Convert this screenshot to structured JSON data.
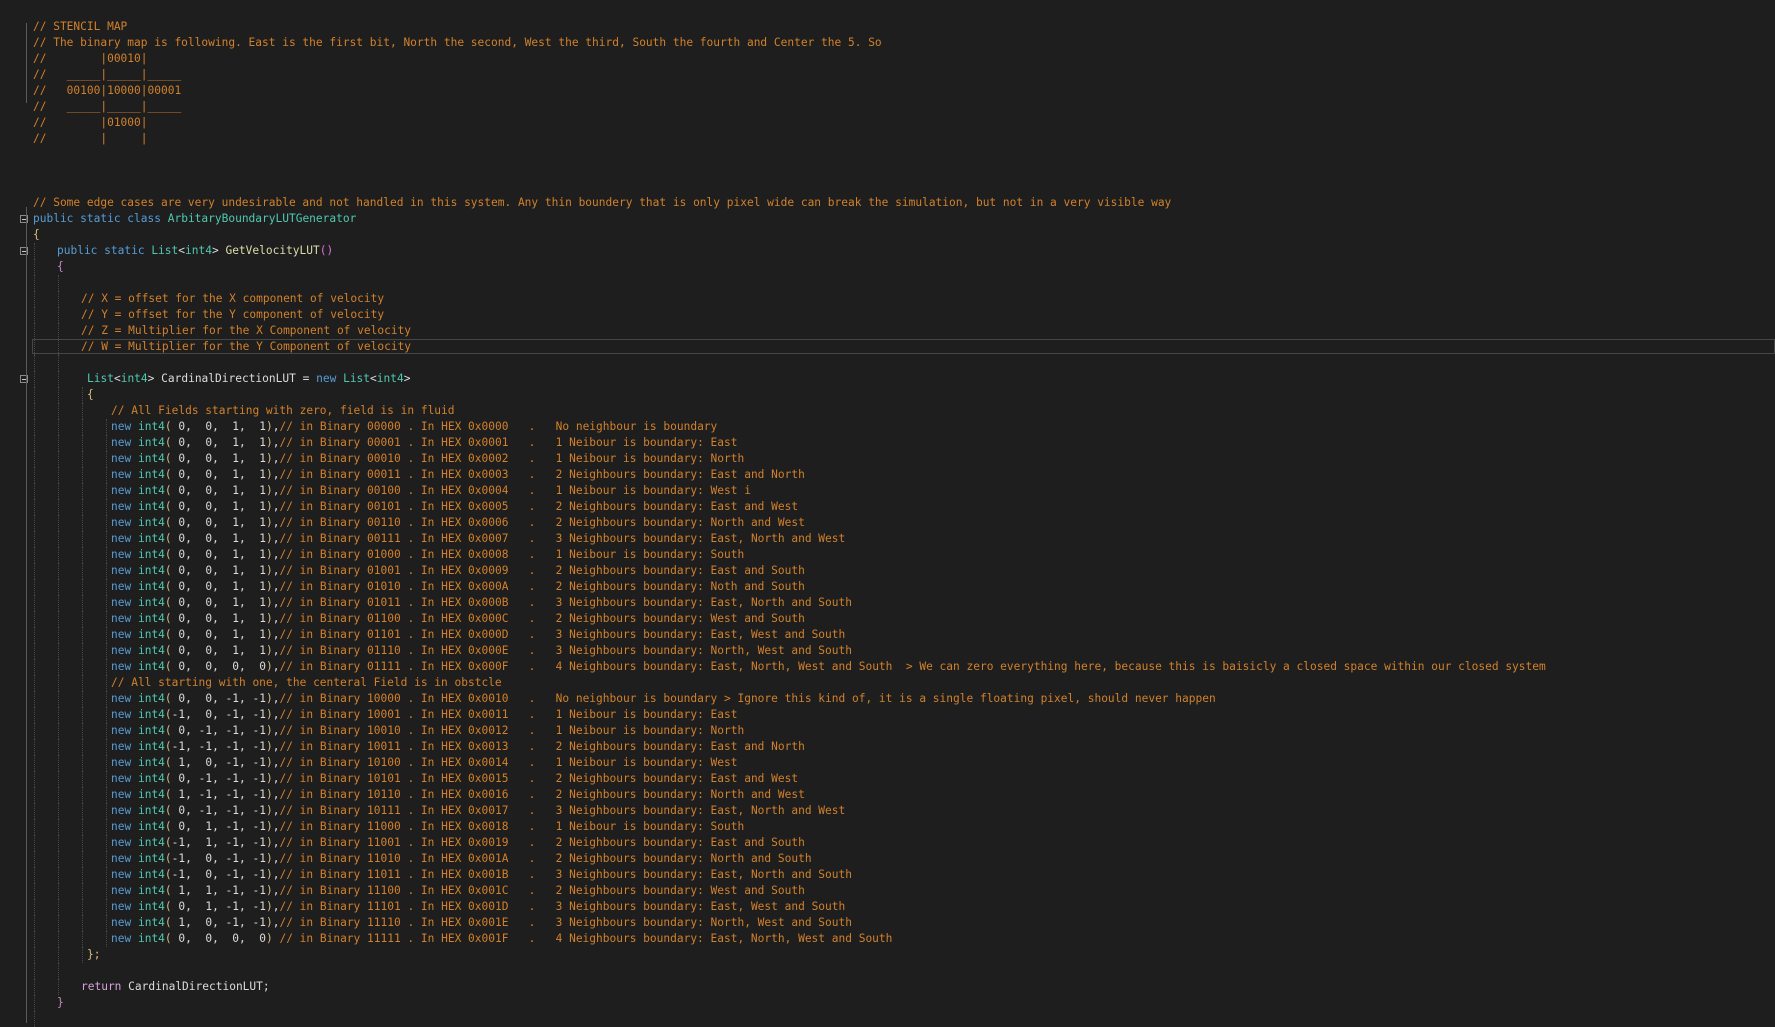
{
  "header_comments": [
    "// STENCIL MAP",
    "// The binary map is following. East is the first bit, North the second, West the third, South the fourth and Center the 5. So",
    "//        |00010|",
    "//   _____|_____|_____",
    "//   00100|10000|00001",
    "//   _____|_____|_____",
    "//        |01000|",
    "//        |     |"
  ],
  "edge_case_comment": "// Some edge cases are very undesirable and not handled in this system. Any thin boundery that is only pixel wide can break the simulation, but not in a very visible way",
  "class_decl": {
    "modifiers": "public static class",
    "name": "ArbitaryBoundaryLUTGenerator"
  },
  "open_brace": "{",
  "close_brace": "}",
  "method_decl": {
    "modifiers": "public static",
    "return_type": "List",
    "generic_arg": "int4",
    "name": "GetVelocityLUT",
    "parens": "()"
  },
  "param_comments": [
    "// X = offset for the X component of velocity",
    "// Y = offset for the Y component of velocity",
    "// Z = Multiplier for the X Component of velocity",
    "// W = Multiplier for the Y Component of velocity"
  ],
  "list_decl": {
    "type": "List",
    "generic_arg": "int4",
    "var": "CardinalDirectionLUT",
    "op": "=",
    "new_kw": "new"
  },
  "init_open": "{",
  "init_close": "};",
  "fluid_comment": "// All Fields starting with zero, field is in fluid",
  "obstacle_comment": "// All starting with one, the centeral Field is in obstcle",
  "entry_keyword": "new",
  "entry_type": "int4",
  "entries_fluid": [
    {
      "args": " 0,  0,  1,  1",
      "comment": "// in Binary 00000 . In HEX 0x0000   .   No neighbour is boundary"
    },
    {
      "args": " 0,  0,  1,  1",
      "comment": "// in Binary 00001 . In HEX 0x0001   .   1 Neibour is boundary: East"
    },
    {
      "args": " 0,  0,  1,  1",
      "comment": "// in Binary 00010 . In HEX 0x0002   .   1 Neibour is boundary: North"
    },
    {
      "args": " 0,  0,  1,  1",
      "comment": "// in Binary 00011 . In HEX 0x0003   .   2 Neighbours boundary: East and North"
    },
    {
      "args": " 0,  0,  1,  1",
      "comment": "// in Binary 00100 . In HEX 0x0004   .   1 Neibour is boundary: West i"
    },
    {
      "args": " 0,  0,  1,  1",
      "comment": "// in Binary 00101 . In HEX 0x0005   .   2 Neighbours boundary: East and West"
    },
    {
      "args": " 0,  0,  1,  1",
      "comment": "// in Binary 00110 . In HEX 0x0006   .   2 Neighbours boundary: North and West"
    },
    {
      "args": " 0,  0,  1,  1",
      "comment": "// in Binary 00111 . In HEX 0x0007   .   3 Neighbours boundary: East, North and West"
    },
    {
      "args": " 0,  0,  1,  1",
      "comment": "// in Binary 01000 . In HEX 0x0008   .   1 Neibour is boundary: South"
    },
    {
      "args": " 0,  0,  1,  1",
      "comment": "// in Binary 01001 . In HEX 0x0009   .   2 Neighbours boundary: East and South"
    },
    {
      "args": " 0,  0,  1,  1",
      "comment": "// in Binary 01010 . In HEX 0x000A   .   2 Neighbours boundary: Noth and South"
    },
    {
      "args": " 0,  0,  1,  1",
      "comment": "// in Binary 01011 . In HEX 0x000B   .   3 Neighbours boundary: East, North and South"
    },
    {
      "args": " 0,  0,  1,  1",
      "comment": "// in Binary 01100 . In HEX 0x000C   .   2 Neighbours boundary: West and South"
    },
    {
      "args": " 0,  0,  1,  1",
      "comment": "// in Binary 01101 . In HEX 0x000D   .   3 Neighbours boundary: East, West and South"
    },
    {
      "args": " 0,  0,  1,  1",
      "comment": "// in Binary 01110 . In HEX 0x000E   .   3 Neighbours boundary: North, West and South"
    },
    {
      "args": " 0,  0,  0,  0",
      "comment": "// in Binary 01111 . In HEX 0x000F   .   4 Neighbours boundary: East, North, West and South  > We can zero everything here, because this is baisicly a closed space within our closed system"
    }
  ],
  "entries_obstacle": [
    {
      "args": " 0,  0, -1, -1",
      "comment": "// in Binary 10000 . In HEX 0x0010   .   No neighbour is boundary > Ignore this kind of, it is a single floating pixel, should never happen"
    },
    {
      "args": "-1,  0, -1, -1",
      "comment": "// in Binary 10001 . In HEX 0x0011   .   1 Neibour is boundary: East"
    },
    {
      "args": " 0, -1, -1, -1",
      "comment": "// in Binary 10010 . In HEX 0x0012   .   1 Neibour is boundary: North"
    },
    {
      "args": "-1, -1, -1, -1",
      "comment": "// in Binary 10011 . In HEX 0x0013   .   2 Neighbours boundary: East and North"
    },
    {
      "args": " 1,  0, -1, -1",
      "comment": "// in Binary 10100 . In HEX 0x0014   .   1 Neibour is boundary: West"
    },
    {
      "args": " 0, -1, -1, -1",
      "comment": "// in Binary 10101 . In HEX 0x0015   .   2 Neighbours boundary: East and West"
    },
    {
      "args": " 1, -1, -1, -1",
      "comment": "// in Binary 10110 . In HEX 0x0016   .   2 Neighbours boundary: North and West"
    },
    {
      "args": " 0, -1, -1, -1",
      "comment": "// in Binary 10111 . In HEX 0x0017   .   3 Neighbours boundary: East, North and West"
    },
    {
      "args": " 0,  1, -1, -1",
      "comment": "// in Binary 11000 . In HEX 0x0018   .   1 Neibour is boundary: South"
    },
    {
      "args": "-1,  1, -1, -1",
      "comment": "// in Binary 11001 . In HEX 0x0019   .   2 Neighbours boundary: East and South"
    },
    {
      "args": "-1,  0, -1, -1",
      "comment": "// in Binary 11010 . In HEX 0x001A   .   2 Neighbours boundary: North and South"
    },
    {
      "args": "-1,  0, -1, -1",
      "comment": "// in Binary 11011 . In HEX 0x001B   .   3 Neighbours boundary: East, North and South"
    },
    {
      "args": " 1,  1, -1, -1",
      "comment": "// in Binary 11100 . In HEX 0x001C   .   2 Neighbours boundary: West and South"
    },
    {
      "args": " 0,  1, -1, -1",
      "comment": "// in Binary 11101 . In HEX 0x001D   .   3 Neighbours boundary: East, West and South"
    },
    {
      "args": " 1,  0, -1, -1",
      "comment": "// in Binary 11110 . In HEX 0x001E   .   3 Neighbours boundary: North, West and South"
    }
  ],
  "last_entry": {
    "args": " 0,  0,  0,  0",
    "comment": " // in Binary 11111 . In HEX 0x001F   .   4 Neighbours boundary: East, North, West and South"
  },
  "return_stmt": {
    "keyword": "return",
    "value": "CardinalDirectionLUT;"
  },
  "colors": {
    "background": "#1e1e1e",
    "comment": "#d1812c",
    "keyword": "#569cd6",
    "type": "#4ec9b0",
    "method": "#dcdcaa",
    "plain": "#dcdcdc",
    "paren": "#da70d6"
  },
  "icons": {
    "fold": "collapse-box-icon"
  }
}
